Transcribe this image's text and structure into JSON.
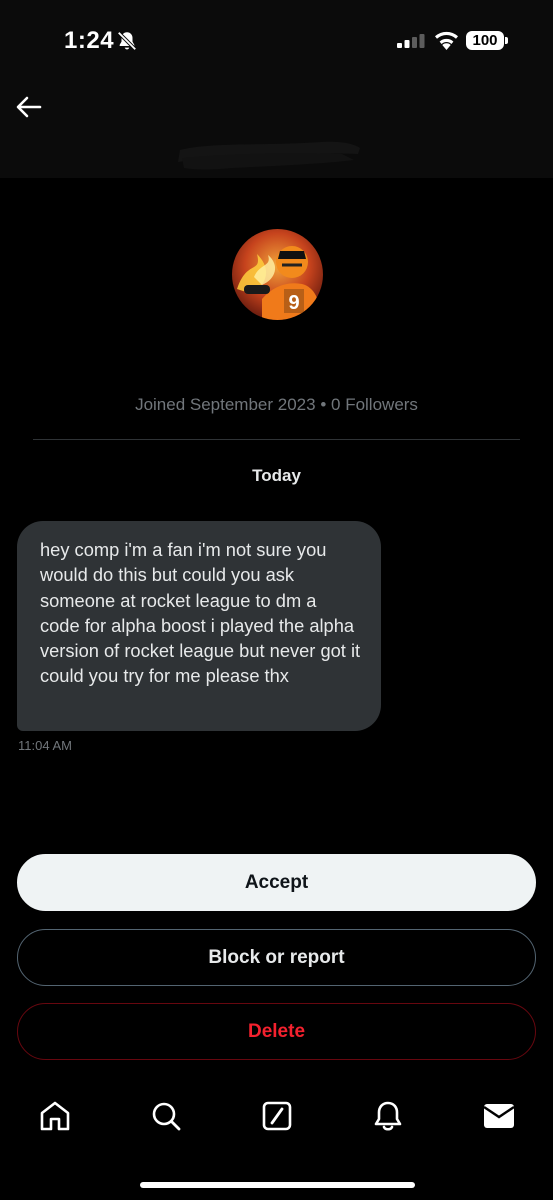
{
  "status_bar": {
    "time": "1:24",
    "battery": "100"
  },
  "profile": {
    "joined": "Joined September 2023",
    "separator": "•",
    "followers": "0 Followers"
  },
  "conversation": {
    "date_separator": "Today",
    "messages": [
      {
        "text": "hey comp i'm a fan i'm not sure you would do this but could you ask someone at rocket league to dm a code for alpha boost i played the alpha version of rocket league but never got it could you try for me please thx",
        "time": "11:04 AM"
      }
    ]
  },
  "actions": {
    "accept": "Accept",
    "block_report": "Block or report",
    "delete": "Delete"
  },
  "colors": {
    "accent_delete": "#f4212e",
    "bubble": "#2f3336",
    "muted_text": "#71767b"
  },
  "icons": [
    "bell-off-icon",
    "signal-icon",
    "wifi-icon",
    "back-arrow-icon",
    "home-icon",
    "search-icon",
    "compose-icon",
    "notifications-icon",
    "messages-icon"
  ]
}
